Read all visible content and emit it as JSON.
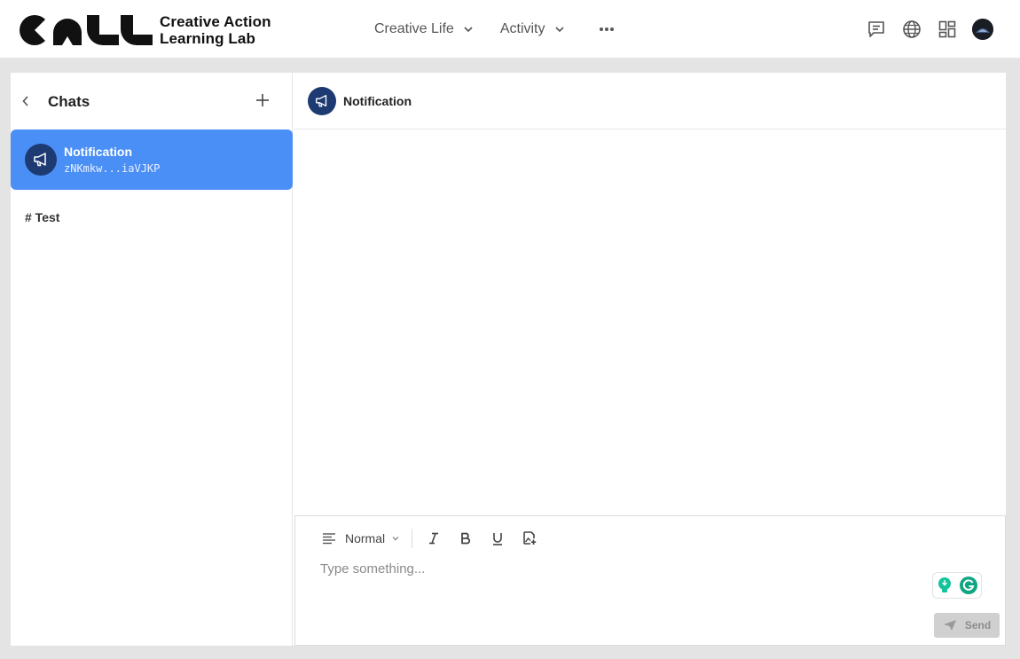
{
  "brand": {
    "line1": "Creative Action",
    "line2": "Learning Lab"
  },
  "nav": {
    "items": [
      {
        "label": "Creative Life"
      },
      {
        "label": "Activity"
      }
    ]
  },
  "header_icons": [
    "chat-icon",
    "globe-icon",
    "apps-grid-icon",
    "user-avatar"
  ],
  "sidebar": {
    "title": "Chats",
    "chats": [
      {
        "name": "Notification",
        "subtitle": "zNKmkw...iaVJKP",
        "icon": "megaphone-icon",
        "selected": true
      }
    ],
    "channels": [
      {
        "label": "# Test"
      }
    ]
  },
  "conversation": {
    "title": "Notification"
  },
  "composer": {
    "format_label": "Normal",
    "placeholder": "Type something...",
    "send_label": "Send"
  },
  "colors": {
    "accent": "#4a8ff5",
    "avatar_bg": "#1d3a72",
    "page_bg": "#e4e4e4",
    "disabled_btn": "#d0d0d0",
    "grammarly": "#15c39a"
  }
}
